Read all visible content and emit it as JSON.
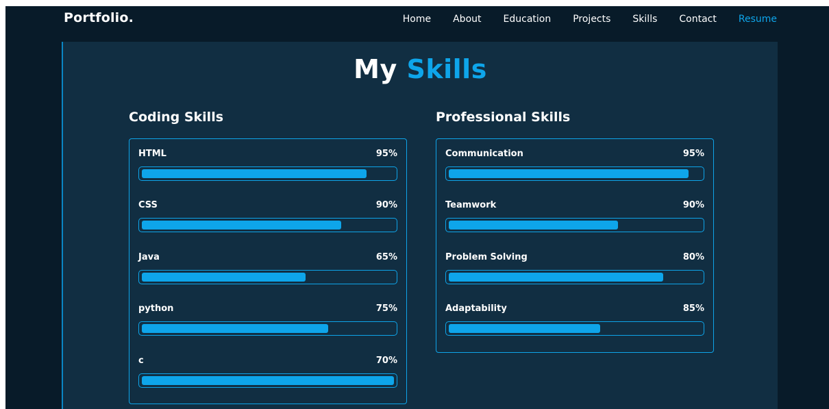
{
  "header": {
    "logo": "Portfolio.",
    "nav": [
      {
        "label": "Home",
        "active": false
      },
      {
        "label": "About",
        "active": false
      },
      {
        "label": "Education",
        "active": false
      },
      {
        "label": "Projects",
        "active": false
      },
      {
        "label": "Skills",
        "active": false
      },
      {
        "label": "Contact",
        "active": false
      },
      {
        "label": "Resume",
        "active": true
      }
    ]
  },
  "skills_section": {
    "title_prefix": "My",
    "title_accent": "Skills",
    "coding": {
      "heading": "Coding Skills",
      "items": [
        {
          "name": "HTML",
          "percent": "95%",
          "fill": 0.89
        },
        {
          "name": "CSS",
          "percent": "90%",
          "fill": 0.79
        },
        {
          "name": "Java",
          "percent": "65%",
          "fill": 0.65
        },
        {
          "name": "python",
          "percent": "75%",
          "fill": 0.74
        },
        {
          "name": "c",
          "percent": "70%",
          "fill": 1.0
        }
      ]
    },
    "professional": {
      "heading": "Professional Skills",
      "items": [
        {
          "name": "Communication",
          "percent": "95%",
          "fill": 0.95
        },
        {
          "name": "Teamwork",
          "percent": "90%",
          "fill": 0.67
        },
        {
          "name": "Problem Solving",
          "percent": "80%",
          "fill": 0.85
        },
        {
          "name": "Adaptability",
          "percent": "85%",
          "fill": 0.6
        }
      ]
    }
  },
  "colors": {
    "background": "#081b29",
    "section": "#112e42",
    "accent": "#0ea5ea",
    "text": "#ffffff"
  }
}
